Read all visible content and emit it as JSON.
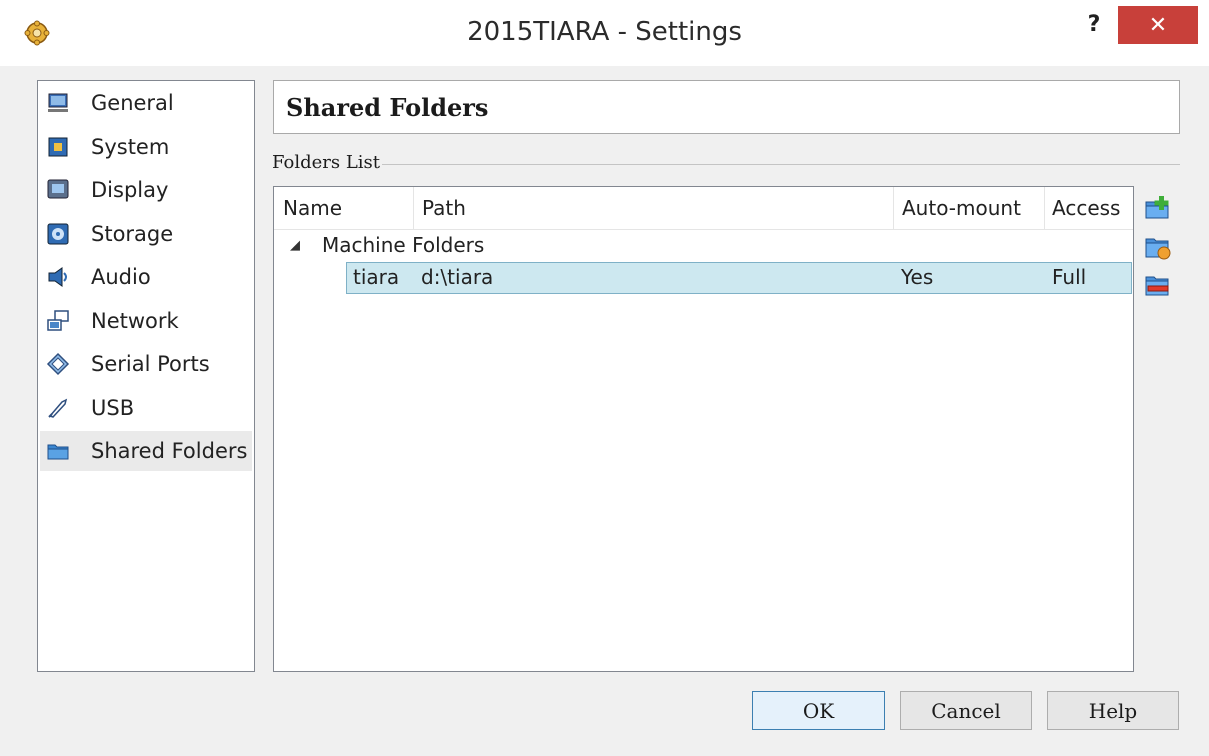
{
  "window": {
    "title": "2015TIARA - Settings",
    "help_label": "?",
    "close_label": "✕"
  },
  "sidebar": {
    "items": [
      {
        "label": "General",
        "icon": "monitor-icon"
      },
      {
        "label": "System",
        "icon": "chip-icon"
      },
      {
        "label": "Display",
        "icon": "display-icon"
      },
      {
        "label": "Storage",
        "icon": "storage-icon"
      },
      {
        "label": "Audio",
        "icon": "speaker-icon"
      },
      {
        "label": "Network",
        "icon": "network-icon"
      },
      {
        "label": "Serial Ports",
        "icon": "serial-port-icon"
      },
      {
        "label": "USB",
        "icon": "usb-icon"
      },
      {
        "label": "Shared Folders",
        "icon": "folder-icon",
        "selected": true
      }
    ]
  },
  "page": {
    "title": "Shared Folders",
    "group_label": "Folders List"
  },
  "table": {
    "columns": [
      "Name",
      "Path",
      "Auto-mount",
      "Access"
    ],
    "group": "Machine Folders",
    "rows": [
      {
        "name": "tiara",
        "path": "d:\\tiara",
        "automount": "Yes",
        "access": "Full"
      }
    ]
  },
  "actions": [
    "add-folder-icon",
    "edit-folder-icon",
    "remove-folder-icon"
  ],
  "buttons": {
    "ok": "OK",
    "cancel": "Cancel",
    "help": "Help"
  },
  "colors": {
    "selection": "#cde8f0",
    "close_button": "#c8403a"
  }
}
